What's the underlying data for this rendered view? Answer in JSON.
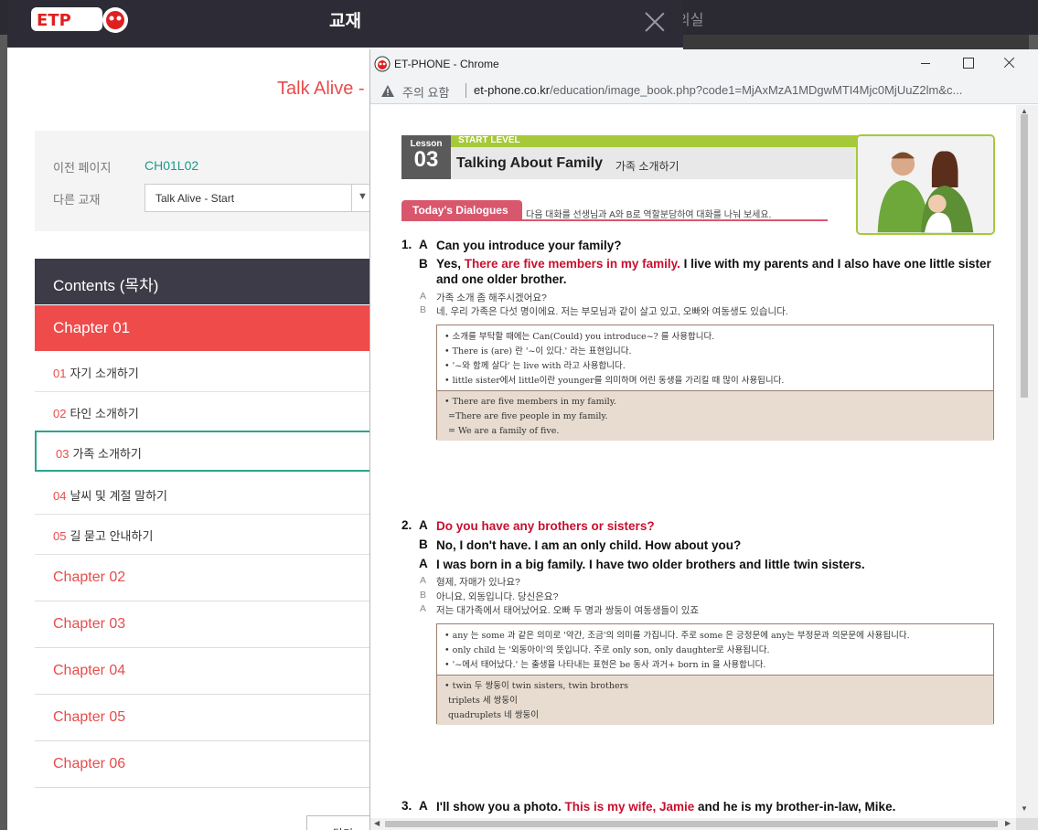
{
  "background": {
    "topbar_menu": "의실"
  },
  "modal": {
    "title": "교재",
    "book_title": "Talk Alive - ",
    "prev_page_label": "이전 페이지",
    "prev_page_value": "CH01L02",
    "other_book_label": "다른 교재",
    "other_book_selected": "Talk Alive - Start",
    "contents_heading": "Contents (목차)",
    "active_chapter": "Chapter 01",
    "lessons": [
      {
        "num": "01",
        "label": "자기 소개하기"
      },
      {
        "num": "02",
        "label": "타인 소개하기"
      },
      {
        "num": "03",
        "label": "가족 소개하기"
      },
      {
        "num": "04",
        "label": "날씨 및 계절 말하기"
      },
      {
        "num": "05",
        "label": "길 묻고 안내하기"
      }
    ],
    "chapters": [
      "Chapter 02",
      "Chapter 03",
      "Chapter 04",
      "Chapter 05",
      "Chapter 06"
    ],
    "bottom_button": "닫기"
  },
  "popup": {
    "window_title": "ET-PHONE - Chrome",
    "warning_text": "주의 요함",
    "url_host": "et-phone.co.kr",
    "url_path": "/education/image_book.php?code1=MjAxMzA1MDgwMTI4Mjc0MjUuZ2lm&c...",
    "colors": {
      "accent_red": "#c8102e",
      "level_green": "#a6c93a",
      "dialogues_pink": "#d9576d"
    }
  },
  "book": {
    "lesson_word": "Lesson",
    "lesson_num": "03",
    "level": "START LEVEL",
    "title_en": "Talking About Family",
    "title_ko": "가족 소개하기",
    "dialogues_tag": "Today's Dialogues",
    "instruction": "다음 대화를 선생님과 A와 B로 역할분담하여 대화를 나눠 보세요.",
    "d1": {
      "num": "1.",
      "a_sp": "A",
      "a_text": "Can you introduce your family?",
      "b_sp": "B",
      "b_pre": "Yes, ",
      "b_red": "There are five members in my family.",
      "b_post": " I live with my parents and I also have one little sister and one older brother.",
      "kr_a": "가족 소개 좀 해주시겠어요?",
      "kr_b": "네, 우리 가족은 다섯 명이에요. 저는 부모님과 같이 살고 있고, 오빠와 여동생도 있습니다.",
      "notes": [
        "• 소개를 부탁할 때에는 Can(Could) you introduce~? 를 사용합니다.",
        "• There is (are) 란 '~이 있다.' 라는 표현입니다.",
        "• '~와 함께 살다' 는 live with 라고 사용합니다.",
        "• little sister에서 little이란 younger를 의미하며 어린 동생을 가리킬 때 많이 사용됩니다."
      ],
      "sub": [
        "• There are five members in my family.",
        "  =There are five people in my family.",
        "  = We are a family of five."
      ]
    },
    "d2": {
      "num": "2.",
      "a_sp": "A",
      "a_red": "Do you have any brothers or sisters?",
      "b_sp": "B",
      "b_text": "No, I don't have. I am an only child. How about you?",
      "a2_sp": "A",
      "a2_text": "I was born in a big family. I have two older brothers and little twin sisters.",
      "kr_a": "형제, 자매가 있나요?",
      "kr_b": "아니요, 외동입니다. 당신은요?",
      "kr_a2": "저는 대가족에서 태어났어요. 오빠 두 명과 쌍둥이 여동생들이 있죠",
      "notes": [
        "• any 는 some 과 같은 의미로 '약간, 조금'의 의미를 가집니다. 주로 some 은 긍정문에 any는 부정문과 의문문에 사용됩니다.",
        "• only child 는 '외동아이'의 뜻입니다. 주로 only son, only daughter로 사용됩니다.",
        "• '~에서 태어났다.' 는 출생을 나타내는 표현은 be 동사 과거+ born in 을 사용합니다."
      ],
      "sub": [
        "• twin 두 쌍둥이 twin sisters, twin brothers",
        "  triplets 세 쌍둥이",
        "  quadruplets 네 쌍둥이"
      ]
    },
    "d3": {
      "num": "3.",
      "a_sp": "A",
      "a_pre": "I'll show you a photo. ",
      "a_red": "This is my wife, Jamie",
      "a_post": " and he is my brother-in-law, Mike."
    }
  }
}
